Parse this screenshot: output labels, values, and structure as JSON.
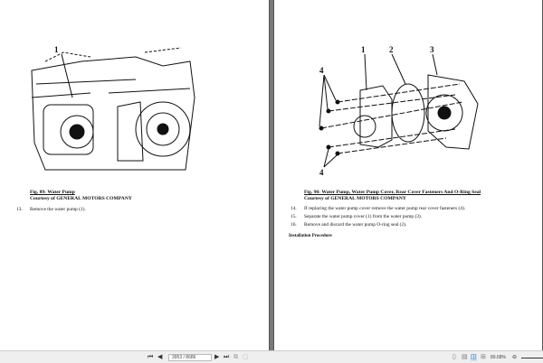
{
  "left_page": {
    "figure_label": "1",
    "caption_title": "Fig. 89: Water Pump",
    "caption_credit": "Courtesy of GENERAL MOTORS COMPANY",
    "steps": [
      {
        "num": "13.",
        "text": "Remove the water pump (1)."
      }
    ]
  },
  "right_page": {
    "figure_labels": [
      "1",
      "2",
      "3",
      "4",
      "4"
    ],
    "caption_title": "Fig. 90: Water Pump, Water Pump Cover, Rear Cover Fasteners And O-Ring Seal",
    "caption_credit": "Courtesy of GENERAL MOTORS COMPANY",
    "steps": [
      {
        "num": "14.",
        "text": "If replacing the water pump cover remove the water pump rear cover fasteners (4)."
      },
      {
        "num": "15.",
        "text": "Separate the water pump cover (1) from the water pump (3)."
      },
      {
        "num": "16.",
        "text": "Remove and discard the water pump O-ring seal (2)."
      }
    ],
    "subheading": "Installation Procedure"
  },
  "toolbar": {
    "page_value": "3953 / 8686",
    "zoom_value": "89.68%"
  }
}
